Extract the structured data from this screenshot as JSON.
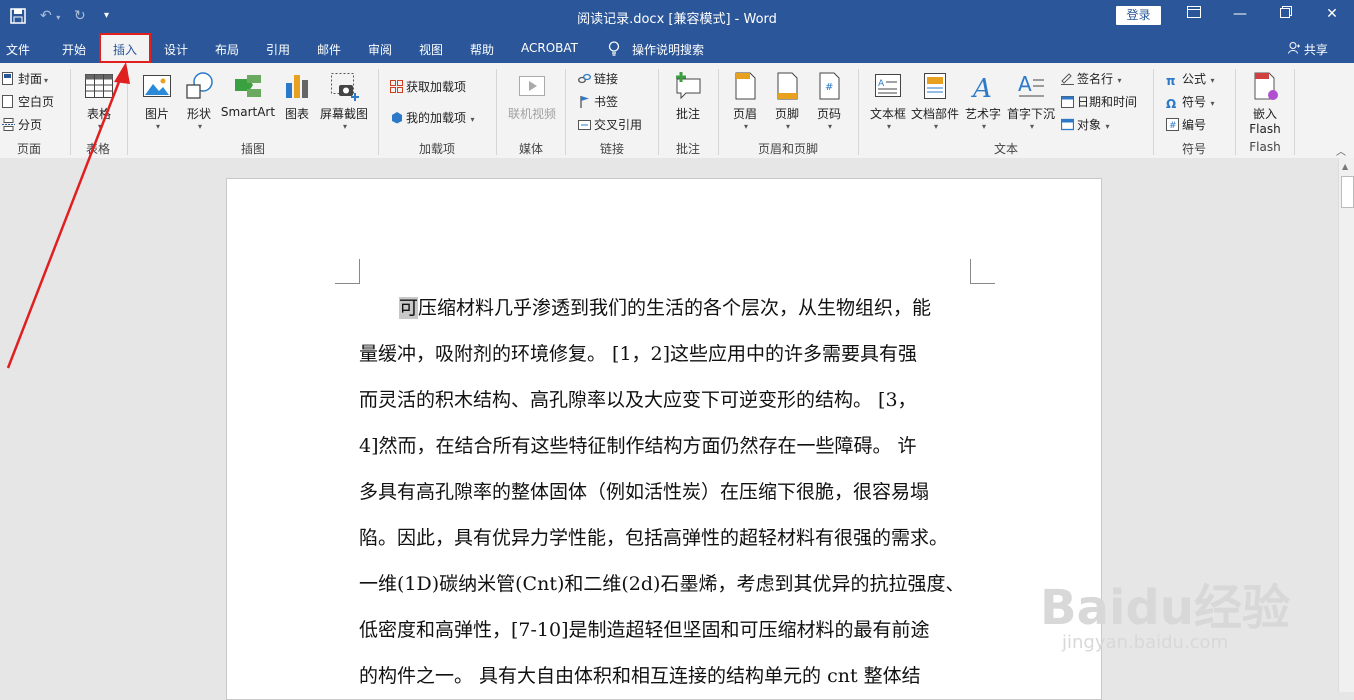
{
  "window": {
    "title": "阅读记录.docx [兼容模式] - Word",
    "login_label": "登录"
  },
  "tabs": [
    "文件",
    "开始",
    "插入",
    "设计",
    "布局",
    "引用",
    "邮件",
    "审阅",
    "视图",
    "帮助",
    "ACROBAT"
  ],
  "active_tab": "插入",
  "tell_me": "操作说明搜索",
  "share": "共享",
  "ribbon": {
    "pages": {
      "items": [
        "封面",
        "空白页",
        "分页"
      ],
      "label": "页面"
    },
    "tables": {
      "table": "表格",
      "label": "表格"
    },
    "illustrations": {
      "items": [
        "图片",
        "形状",
        "SmartArt",
        "图表",
        "屏幕截图"
      ],
      "label": "插图"
    },
    "addins": {
      "get": "获取加载项",
      "mine": "我的加载项",
      "label": "加载项"
    },
    "media": {
      "online_video": "联机视频",
      "label": "媒体"
    },
    "links": {
      "items": [
        "链接",
        "书签",
        "交叉引用"
      ],
      "label": "链接"
    },
    "comments": {
      "comment": "批注",
      "label": "批注"
    },
    "header_footer": {
      "items": [
        "页眉",
        "页脚",
        "页码"
      ],
      "label": "页眉和页脚"
    },
    "text": {
      "items": [
        "文本框",
        "文档部件",
        "艺术字",
        "首字下沉"
      ],
      "small": [
        "签名行",
        "日期和时间",
        "对象"
      ],
      "label": "文本"
    },
    "symbols": {
      "items": [
        "公式",
        "符号",
        "编号"
      ],
      "label": "符号"
    },
    "flash": {
      "embed": "嵌入",
      "flash": "Flash",
      "label": "Flash"
    }
  },
  "document": {
    "lines": [
      "可压缩材料几乎渗透到我们的生活的各个层次，从生物组织，能",
      "量缓冲，吸附剂的环境修复。 [1，2]这些应用中的许多需要具有强",
      "而灵活的积木结构、高孔隙率以及大应变下可逆变形的结构。 [3，",
      "4]然而，在结合所有这些特征制作结构方面仍然存在一些障碍。 许",
      "多具有高孔隙率的整体固体（例如活性炭）在压缩下很脆，很容易塌",
      "陷。因此，具有优异力学性能，包括高弹性的超轻材料有很强的需求。",
      "一维(1D)碳纳米管(Cnt)和二维(2d)石墨烯，考虑到其优异的抗拉强度、",
      "低密度和高弹性，[7-10]是制造超轻但坚固和可压缩材料的最有前途",
      "的构件之一。 具有大自由体积和相互连接的结构单元的 cnt 整体结"
    ]
  },
  "watermark": {
    "brand": "Baidu经验",
    "url": "jingyan.baidu.com"
  },
  "colors": {
    "accent": "#2b579a",
    "annotation": "#e02020"
  }
}
